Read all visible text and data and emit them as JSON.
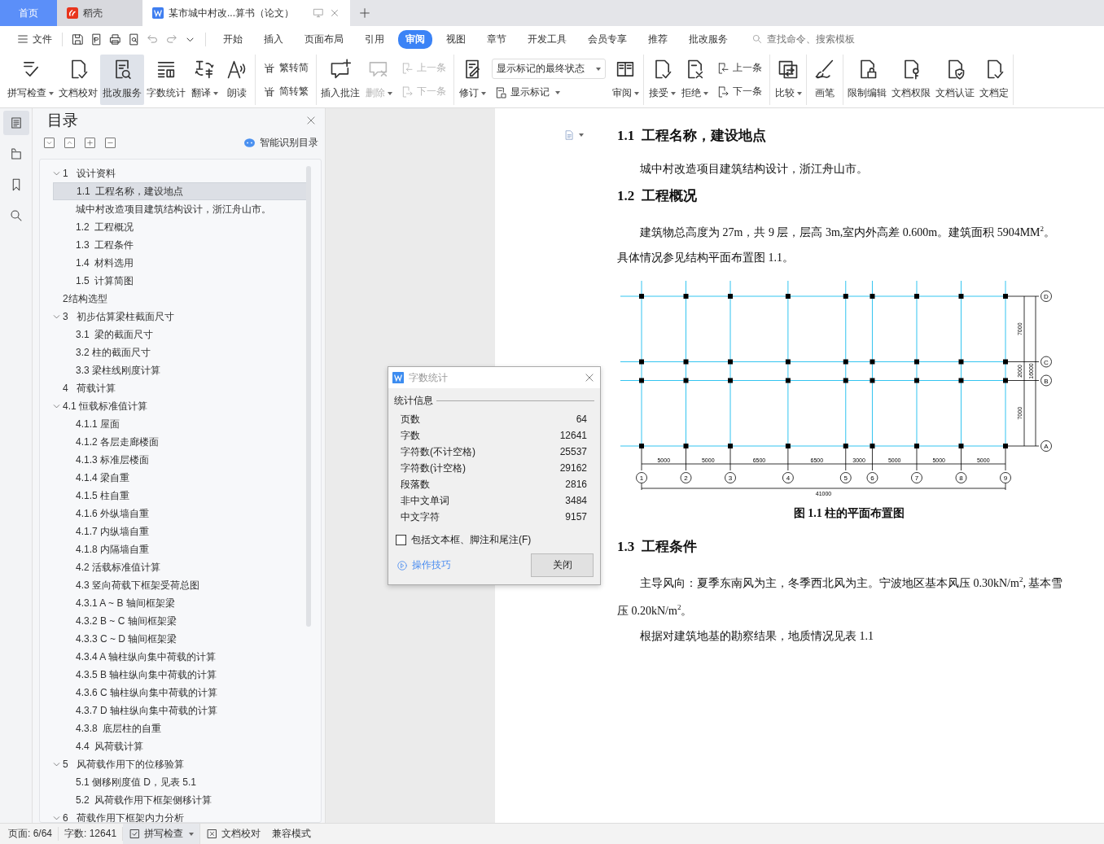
{
  "tabs": [
    {
      "label": "首页",
      "kind": "home",
      "selected": false
    },
    {
      "label": "稻壳",
      "kind": "docer",
      "selected": false
    },
    {
      "label": "某市城中村改...算书（论文）",
      "kind": "document",
      "selected": true
    }
  ],
  "menu": {
    "file": "文件",
    "tabs": [
      {
        "label": "开始",
        "selected": false
      },
      {
        "label": "插入",
        "selected": false
      },
      {
        "label": "页面布局",
        "selected": false
      },
      {
        "label": "引用",
        "selected": false
      },
      {
        "label": "审阅",
        "selected": true
      },
      {
        "label": "视图",
        "selected": false
      },
      {
        "label": "章节",
        "selected": false
      },
      {
        "label": "开发工具",
        "selected": false
      },
      {
        "label": "会员专享",
        "selected": false
      },
      {
        "label": "推荐",
        "selected": false
      },
      {
        "label": "批改服务",
        "selected": false
      }
    ],
    "search": {
      "placeholder": "查找命令、搜索模板"
    }
  },
  "ribbon": [
    {
      "items": [
        {
          "kind": "large",
          "label": "拼写检查",
          "dropdown": true,
          "disabled": false,
          "pressed": false
        },
        {
          "kind": "large",
          "label": "文档校对",
          "dropdown": false,
          "disabled": false,
          "pressed": false
        },
        {
          "kind": "large",
          "label": "批改服务",
          "dropdown": false,
          "disabled": false,
          "pressed": true
        },
        {
          "kind": "large",
          "label": "字数统计",
          "dropdown": false,
          "disabled": false,
          "pressed": false
        },
        {
          "kind": "large",
          "label": "翻译",
          "dropdown": true,
          "disabled": false,
          "pressed": false
        },
        {
          "kind": "large",
          "label": "朗读",
          "dropdown": false,
          "disabled": false,
          "pressed": false
        }
      ]
    },
    {
      "items": [
        {
          "kind": "stack",
          "rows": [
            {
              "kind": "small",
              "label": "繁转简",
              "dropdown": false,
              "disabled": false
            },
            {
              "kind": "small",
              "label": "简转繁",
              "dropdown": false,
              "disabled": false
            }
          ]
        }
      ]
    },
    {
      "items": [
        {
          "kind": "large",
          "label": "插入批注",
          "dropdown": false,
          "disabled": false,
          "pressed": false
        },
        {
          "kind": "large",
          "label": "删除",
          "dropdown": true,
          "disabled": true,
          "pressed": false
        },
        {
          "kind": "stack",
          "rows": [
            {
              "kind": "small",
              "label": "上一条",
              "dropdown": false,
              "disabled": true
            },
            {
              "kind": "small",
              "label": "下一条",
              "dropdown": false,
              "disabled": true
            }
          ]
        }
      ]
    },
    {
      "items": [
        {
          "kind": "large",
          "label": "修订",
          "dropdown": true,
          "disabled": false,
          "pressed": false
        },
        {
          "kind": "stack",
          "rows": [
            {
              "kind": "select",
              "value": "显示标记的最终状态"
            },
            {
              "kind": "small",
              "label": "显示标记",
              "dropdown": true,
              "disabled": false
            }
          ]
        },
        {
          "kind": "large",
          "label": "审阅",
          "dropdown": true,
          "disabled": false,
          "pressed": false
        }
      ]
    },
    {
      "items": [
        {
          "kind": "large",
          "label": "接受",
          "dropdown": true,
          "disabled": false,
          "pressed": false
        },
        {
          "kind": "large",
          "label": "拒绝",
          "dropdown": true,
          "disabled": false,
          "pressed": false
        },
        {
          "kind": "stack",
          "rows": [
            {
              "kind": "small",
              "label": "上一条",
              "dropdown": false,
              "disabled": false
            },
            {
              "kind": "small",
              "label": "下一条",
              "dropdown": false,
              "disabled": false
            }
          ]
        }
      ]
    },
    {
      "items": [
        {
          "kind": "large",
          "label": "比较",
          "dropdown": true,
          "disabled": false,
          "pressed": false
        }
      ]
    },
    {
      "items": [
        {
          "kind": "large",
          "label": "画笔",
          "dropdown": false,
          "disabled": false,
          "pressed": false
        }
      ]
    },
    {
      "items": [
        {
          "kind": "large",
          "label": "限制编辑",
          "dropdown": false,
          "disabled": false,
          "pressed": false
        },
        {
          "kind": "large",
          "label": "文档权限",
          "dropdown": false,
          "disabled": false,
          "pressed": false
        },
        {
          "kind": "large",
          "label": "文档认证",
          "dropdown": false,
          "disabled": false,
          "pressed": false
        },
        {
          "kind": "large",
          "label": "文档定",
          "dropdown": false,
          "disabled": false,
          "pressed": false
        }
      ]
    }
  ],
  "sidebar": [
    {
      "selected": true
    },
    {
      "selected": false
    },
    {
      "selected": false
    },
    {
      "selected": false
    }
  ],
  "toc": {
    "title": "目录",
    "smart_button": "智能识别目录",
    "items": [
      {
        "text": "1   设计资料",
        "selected": false,
        "expanded": true,
        "children": [
          {
            "text": "1.1  工程名称，建设地点",
            "selected": true
          },
          {
            "text": "城中村改造项目建筑结构设计，浙江舟山市。",
            "selected": false
          },
          {
            "text": "1.2  工程概况",
            "selected": false
          },
          {
            "text": "1.3  工程条件",
            "selected": false
          },
          {
            "text": "1.4  材料选用",
            "selected": false
          },
          {
            "text": "1.5  计算简图",
            "selected": false
          }
        ]
      },
      {
        "text": "2结构选型",
        "selected": false
      },
      {
        "text": "3   初步估算梁柱截面尺寸",
        "selected": false,
        "expanded": true,
        "children": [
          {
            "text": "3.1  梁的截面尺寸",
            "selected": false
          },
          {
            "text": "3.2 柱的截面尺寸",
            "selected": false
          },
          {
            "text": "3.3 梁柱线刚度计算",
            "selected": false
          }
        ]
      },
      {
        "text": "4   荷载计算",
        "selected": false
      },
      {
        "text": "4.1 恒载标准值计算",
        "selected": false,
        "expanded": true,
        "children": [
          {
            "text": "4.1.1 屋面",
            "selected": false
          },
          {
            "text": "4.1.2 各层走廊楼面",
            "selected": false
          },
          {
            "text": "4.1.3 标准层楼面",
            "selected": false
          },
          {
            "text": "4.1.4 梁自重",
            "selected": false
          },
          {
            "text": "4.1.5 柱自重",
            "selected": false
          },
          {
            "text": "4.1.6 外纵墙自重",
            "selected": false
          },
          {
            "text": "4.1.7 内纵墙自重",
            "selected": false
          },
          {
            "text": "4.1.8 内隔墙自重",
            "selected": false
          },
          {
            "text": "4.2 活载标准值计算",
            "selected": false
          },
          {
            "text": "4.3 竖向荷载下框架受荷总图",
            "selected": false
          },
          {
            "text": "4.3.1 A ~ B 轴间框架梁",
            "selected": false
          },
          {
            "text": "4.3.2 B ~ C 轴间框架梁",
            "selected": false
          },
          {
            "text": "4.3.3 C ~ D 轴间框架梁",
            "selected": false
          },
          {
            "text": "4.3.4 A 轴柱纵向集中荷载的计算",
            "selected": false
          },
          {
            "text": "4.3.5 B 轴柱纵向集中荷载的计算",
            "selected": false
          },
          {
            "text": "4.3.6 C 轴柱纵向集中荷载的计算",
            "selected": false
          },
          {
            "text": "4.3.7 D 轴柱纵向集中荷载的计算",
            "selected": false
          },
          {
            "text": "4.3.8  底层柱的自重",
            "selected": false
          },
          {
            "text": "4.4  风荷载计算",
            "selected": false
          }
        ]
      },
      {
        "text": "5   风荷载作用下的位移验算",
        "selected": false,
        "expanded": true,
        "children": [
          {
            "text": "5.1 侧移刚度值 D，见表 5.1",
            "selected": false
          },
          {
            "text": "5.2  风荷载作用下框架侧移计算",
            "selected": false
          }
        ]
      },
      {
        "text": "6   荷载作用下框架内力分析",
        "selected": false,
        "expanded": true
      }
    ]
  },
  "document": {
    "blocks": [
      {
        "kind": "heading",
        "text": "1.1  工程名称，建设地点"
      },
      {
        "kind": "paragraph",
        "text": "城中村改造项目建筑结构设计，浙江舟山市。"
      },
      {
        "kind": "heading",
        "text": "1.2  工程概况"
      },
      {
        "kind": "paragraph",
        "text": "建筑物总高度为 27m，共 9 层，层高 3m,室内外高差 0.600m。建筑面积 5904MM$^{2}$。"
      },
      {
        "kind": "plain",
        "text": "具体情况参见结构平面布置图 1.1。"
      },
      {
        "kind": "figure",
        "x_axes": [
          "1",
          "2",
          "3",
          "4",
          "5",
          "6",
          "7",
          "8",
          "9"
        ],
        "x_spans": [
          "5000",
          "5000",
          "6500",
          "6500",
          "3000",
          "5000",
          "5000",
          "5000"
        ],
        "x_total": "41000",
        "y_axes": [
          "D",
          "C",
          "B",
          "A"
        ],
        "y_spans": [
          "7000",
          "2000",
          "7000"
        ],
        "y_total": "16000",
        "caption": "图 1.1 柱的平面布置图"
      },
      {
        "kind": "heading",
        "text": "1.3  工程条件"
      },
      {
        "kind": "paragraph",
        "text": "主导风向：夏季东南风为主，冬季西北风为主。宁波地区基本风压 0.30kN/m$^{2}$, 基本雪压 0.20kN/m$^{2}$。"
      },
      {
        "kind": "paragraph",
        "text": "根据对建筑地基的勘察结果，地质情况见表 1.1"
      }
    ]
  },
  "dialog": {
    "title": "字数统计",
    "section": "统计信息",
    "rows": [
      {
        "label": "页数",
        "value": "64"
      },
      {
        "label": "字数",
        "value": "12641"
      },
      {
        "label": "字符数(不计空格)",
        "value": "25537"
      },
      {
        "label": "字符数(计空格)",
        "value": "29162"
      },
      {
        "label": "段落数",
        "value": "2816"
      },
      {
        "label": "非中文单词",
        "value": "3484"
      },
      {
        "label": "中文字符",
        "value": "9157"
      }
    ],
    "checkbox": {
      "label": "包括文本框、脚注和尾注(F)",
      "checked": false
    },
    "tips_link": "操作技巧",
    "close_button": "关闭"
  },
  "status_bar": {
    "page": "页面: 6/64",
    "words": "字数: 12641",
    "spell_check": "拼写检查",
    "doc_check": "文档校对",
    "mode": "兼容模式"
  }
}
